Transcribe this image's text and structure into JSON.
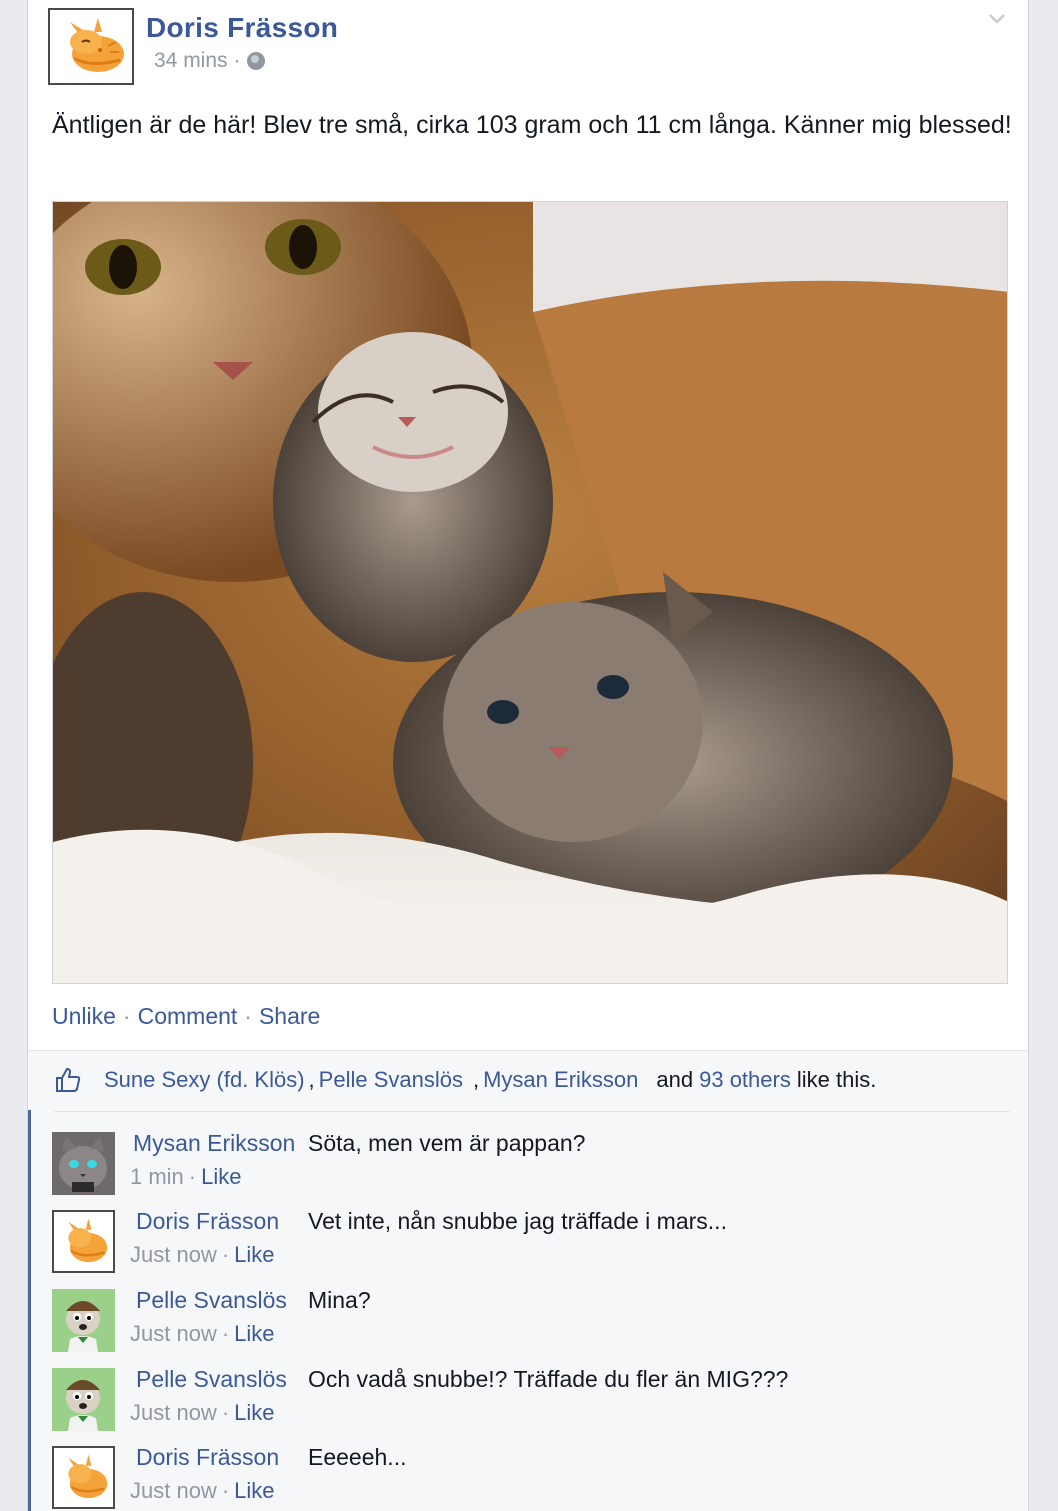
{
  "post": {
    "author": "Doris Frässon",
    "time": "34 mins",
    "meta_sep": "·",
    "privacy_icon": "globe-icon",
    "options_icon": "chevron-down-icon",
    "text": "Äntligen är de här! Blev tre små, cirka 103 gram och 11 cm långa. Känner mig blessed!",
    "photo_icon": "kittens-photo"
  },
  "actions": {
    "unlike": "Unlike",
    "comment": "Comment",
    "share": "Share",
    "sep": "·"
  },
  "likes": {
    "icon": "thumbs-up-icon",
    "names": [
      "Sune Sexy (fd. Klös)",
      "Pelle Svanslös",
      "Mysan Eriksson"
    ],
    "comma": ",",
    "and": "and",
    "others": "93 others",
    "suffix": "like this."
  },
  "comments": [
    {
      "author": "Mysan Eriksson",
      "text": "Söta, men vem är pappan?",
      "time": "1 min",
      "like": "Like",
      "avatar": "grey-cat-avatar"
    },
    {
      "author": "Doris Frässon",
      "text": "Vet inte, nån snubbe jag träffade i mars...",
      "time": "Just now",
      "like": "Like",
      "avatar": "orange-cat-avatar"
    },
    {
      "author": "Pelle Svanslös",
      "text": "Mina?",
      "time": "Just now",
      "like": "Like",
      "avatar": "cartoon-cat-avatar"
    },
    {
      "author": "Pelle Svanslös",
      "text": "Och vadå snubbe!? Träffade du fler än MIG???",
      "time": "Just now",
      "like": "Like",
      "avatar": "cartoon-cat-avatar"
    },
    {
      "author": "Doris Frässon",
      "text": "Eeeeeh...",
      "time": "Just now",
      "like": "Like",
      "avatar": "orange-cat-avatar"
    }
  ],
  "colors": {
    "link": "#3b5998",
    "meta": "#9197a3",
    "feedback_bg": "#f6f7f9",
    "accent_bar": "#4e69a2"
  }
}
